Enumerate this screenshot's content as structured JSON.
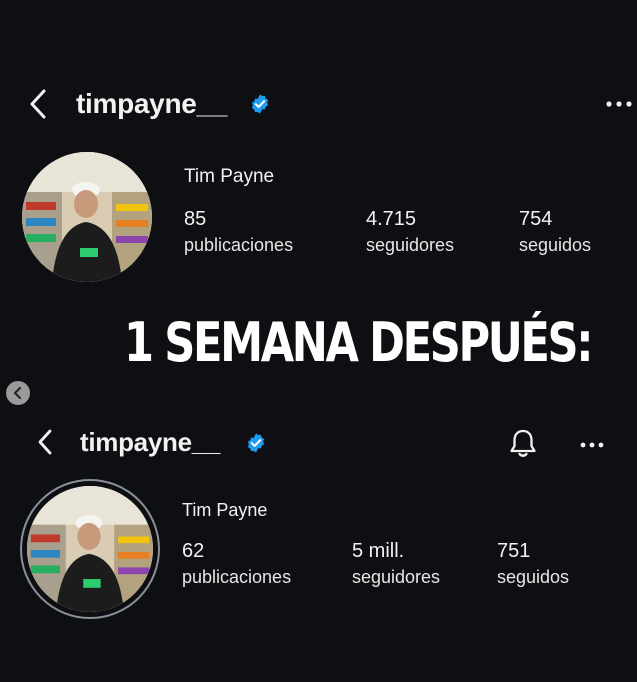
{
  "headline": "1 SEMANA DESPUÉS:",
  "before": {
    "username": "timpayne__",
    "name": "Tim Payne",
    "stats": [
      {
        "value": "85",
        "label": "publicaciones"
      },
      {
        "value": "4.715",
        "label": "seguidores"
      },
      {
        "value": "754",
        "label": "seguidos"
      }
    ]
  },
  "after": {
    "username": "timpayne__",
    "name": "Tim Payne",
    "stats": [
      {
        "value": "62",
        "label": "publicaciones"
      },
      {
        "value": "5 mill.",
        "label": "seguidores"
      },
      {
        "value": "751",
        "label": "seguidos"
      }
    ]
  },
  "icons": {
    "back": "chevron-left-icon",
    "verified": "verified-badge-icon",
    "more": "more-options-icon",
    "notifications": "bell-icon",
    "carousel_prev": "carousel-prev-icon"
  },
  "colors": {
    "background": "#0e0f12",
    "verified_blue": "#1d9bf0",
    "text": "#f2f2f2"
  }
}
